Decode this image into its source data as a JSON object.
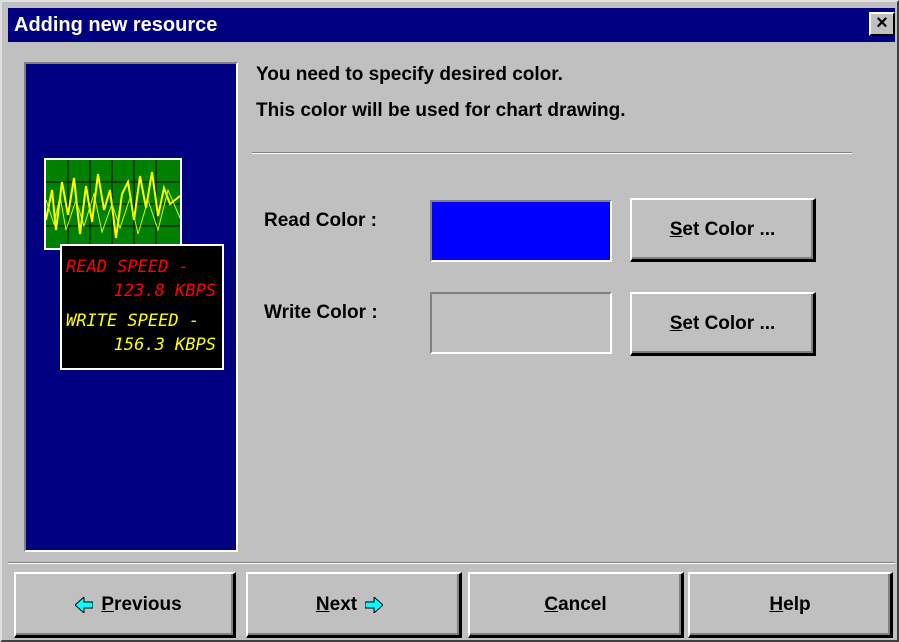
{
  "window": {
    "title": "Adding new resource",
    "close_glyph": "✕"
  },
  "illustration": {
    "read_line1": "READ SPEED -",
    "read_line2": "123.8 KBPS",
    "write_line1": "WRITE SPEED -",
    "write_line2": "156.3 KBPS",
    "read_text_color": "#ff0000",
    "write_text_color": "#ffff00",
    "scope_bg": "#008000",
    "scope_trace": "#ffff00"
  },
  "instructions": {
    "line1": "You need to specify desired color.",
    "line2": "This color will be used for chart drawing."
  },
  "read_color": {
    "label": "Read Color :",
    "value": "#0000ff",
    "button_mnemonic": "S",
    "button_rest": "et Color ..."
  },
  "write_color": {
    "label": "Write Color :",
    "value": "#c0c0c0",
    "button_mnemonic": "S",
    "button_rest": "et Color ..."
  },
  "footer": {
    "previous": {
      "mnemonic": "P",
      "rest": "revious",
      "icon": "arrow-left-icon"
    },
    "next": {
      "mnemonic": "N",
      "rest": "ext",
      "icon": "arrow-right-icon"
    },
    "cancel": {
      "mnemonic": "C",
      "rest": "ancel"
    },
    "help": {
      "mnemonic": "H",
      "rest": "elp"
    },
    "arrow_color": "#00ffff"
  }
}
